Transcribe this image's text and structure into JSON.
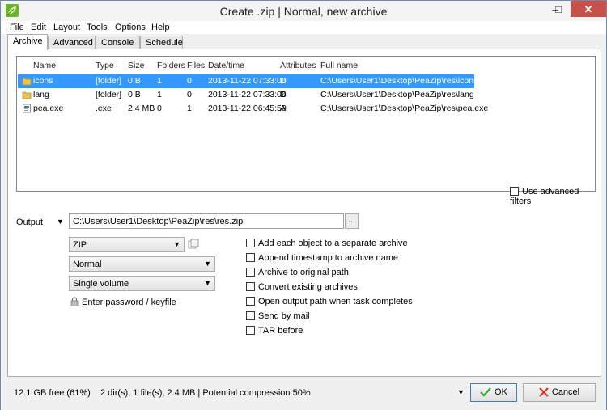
{
  "window": {
    "title": "Create .zip | Normal, new archive"
  },
  "menu": [
    "File",
    "Edit",
    "Layout",
    "Tools",
    "Options",
    "Help"
  ],
  "tabs": [
    "Archive",
    "Advanced",
    "Console",
    "Schedule"
  ],
  "filelist": {
    "columns": [
      "Name",
      "Type",
      "Size",
      "Folders",
      "Files",
      "Date/time",
      "Attributes",
      "Full name"
    ],
    "rows": [
      {
        "name": "icons",
        "type": "[folder]",
        "size": "0 B",
        "folders": "1",
        "files": "0",
        "datetime": "2013-11-22 07:33:06",
        "attributes": "D",
        "fullname": "C:\\Users\\User1\\Desktop\\PeaZip\\res\\icons",
        "icon": "folder-icon"
      },
      {
        "name": "lang",
        "type": "[folder]",
        "size": "0 B",
        "folders": "1",
        "files": "0",
        "datetime": "2013-11-22 07:33:06",
        "attributes": "D",
        "fullname": "C:\\Users\\User1\\Desktop\\PeaZip\\res\\lang",
        "icon": "folder-icon"
      },
      {
        "name": "pea.exe",
        "type": ".exe",
        "size": "2.4 MB",
        "folders": "0",
        "files": "1",
        "datetime": "2013-11-22 06:45:50",
        "attributes": "A",
        "fullname": "C:\\Users\\User1\\Desktop\\PeaZip\\res\\pea.exe",
        "icon": "exe-icon"
      }
    ]
  },
  "advanced_filters_label": "Use advanced filters",
  "output": {
    "label": "Output",
    "path": "C:\\Users\\User1\\Desktop\\PeaZip\\res\\res.zip",
    "browse_label": "..."
  },
  "format_select": "ZIP",
  "level_select": "Normal",
  "volume_select": "Single volume",
  "password_label": "Enter password / keyfile",
  "options": [
    "Add each object to a separate archive",
    "Append timestamp to archive name",
    "Archive to original path",
    "Convert existing archives",
    "Open output path when task completes",
    "Send by mail",
    "TAR before"
  ],
  "status": "12.1 GB free (61%)    2 dir(s), 1 file(s), 2.4 MB | Potential compression 50%",
  "buttons": {
    "ok": "OK",
    "cancel": "Cancel"
  },
  "colors": {
    "selection": "#3399ff",
    "close": "#c7504a"
  }
}
